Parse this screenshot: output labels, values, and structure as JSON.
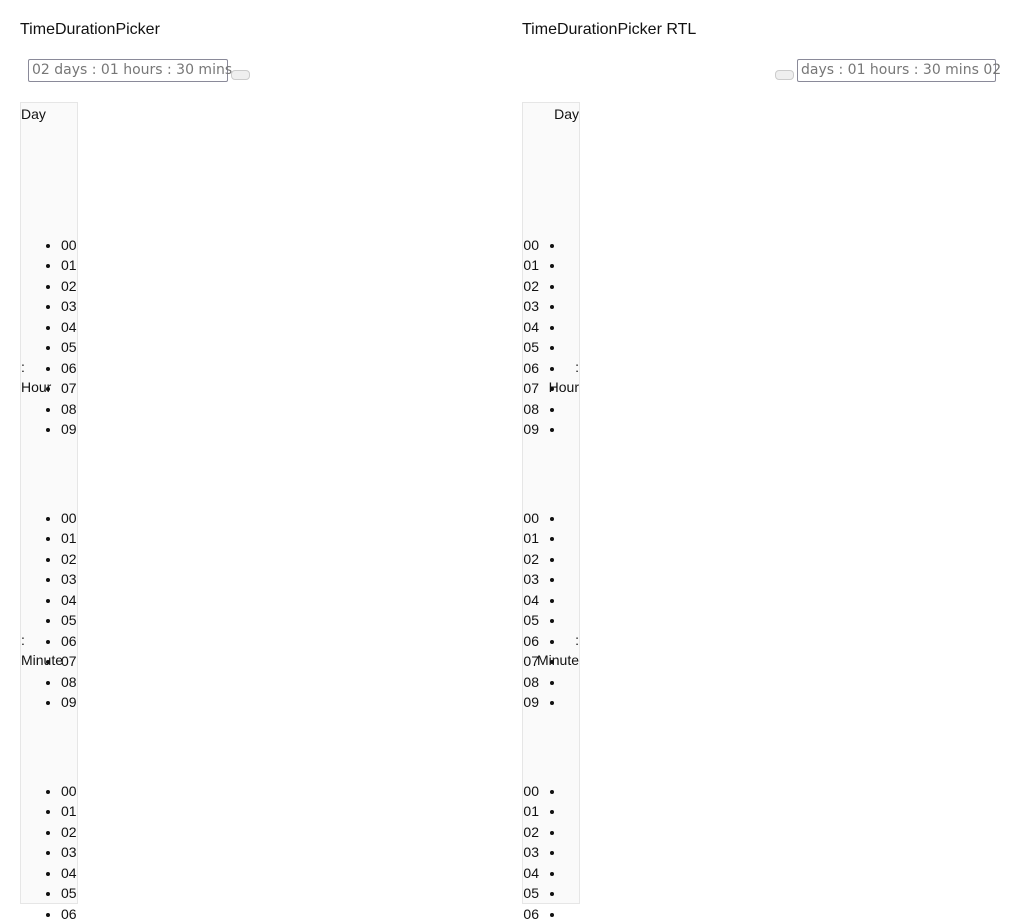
{
  "ltr": {
    "title": "TimeDurationPicker",
    "input_value": "02 days : 01 hours : 30 mins",
    "labels": {
      "day": "Day",
      "hour_sep": ":",
      "hour": "Hour",
      "minute_sep": ":",
      "minute": "Minute"
    },
    "day_options": [
      "00",
      "01",
      "02",
      "03",
      "04",
      "05",
      "06",
      "07",
      "08",
      "09"
    ],
    "hour_options": [
      "00",
      "01",
      "02",
      "03",
      "04",
      "05",
      "06",
      "07",
      "08",
      "09"
    ],
    "minute_options": [
      "00",
      "01",
      "02",
      "03",
      "04",
      "05",
      "06"
    ]
  },
  "rtl": {
    "title": "TimeDurationPicker RTL",
    "input_value": "days : 01 hours : 30 mins 02",
    "labels": {
      "day": "Day",
      "hour_sep": ":",
      "hour": "Hour",
      "minute_sep": ":",
      "minute": "Minute"
    },
    "day_options": [
      "00",
      "01",
      "02",
      "03",
      "04",
      "05",
      "06",
      "07",
      "08",
      "09"
    ],
    "hour_options": [
      "00",
      "01",
      "02",
      "03",
      "04",
      "05",
      "06",
      "07",
      "08",
      "09"
    ],
    "minute_options": [
      "00",
      "01",
      "02",
      "03",
      "04",
      "05",
      "06"
    ]
  }
}
